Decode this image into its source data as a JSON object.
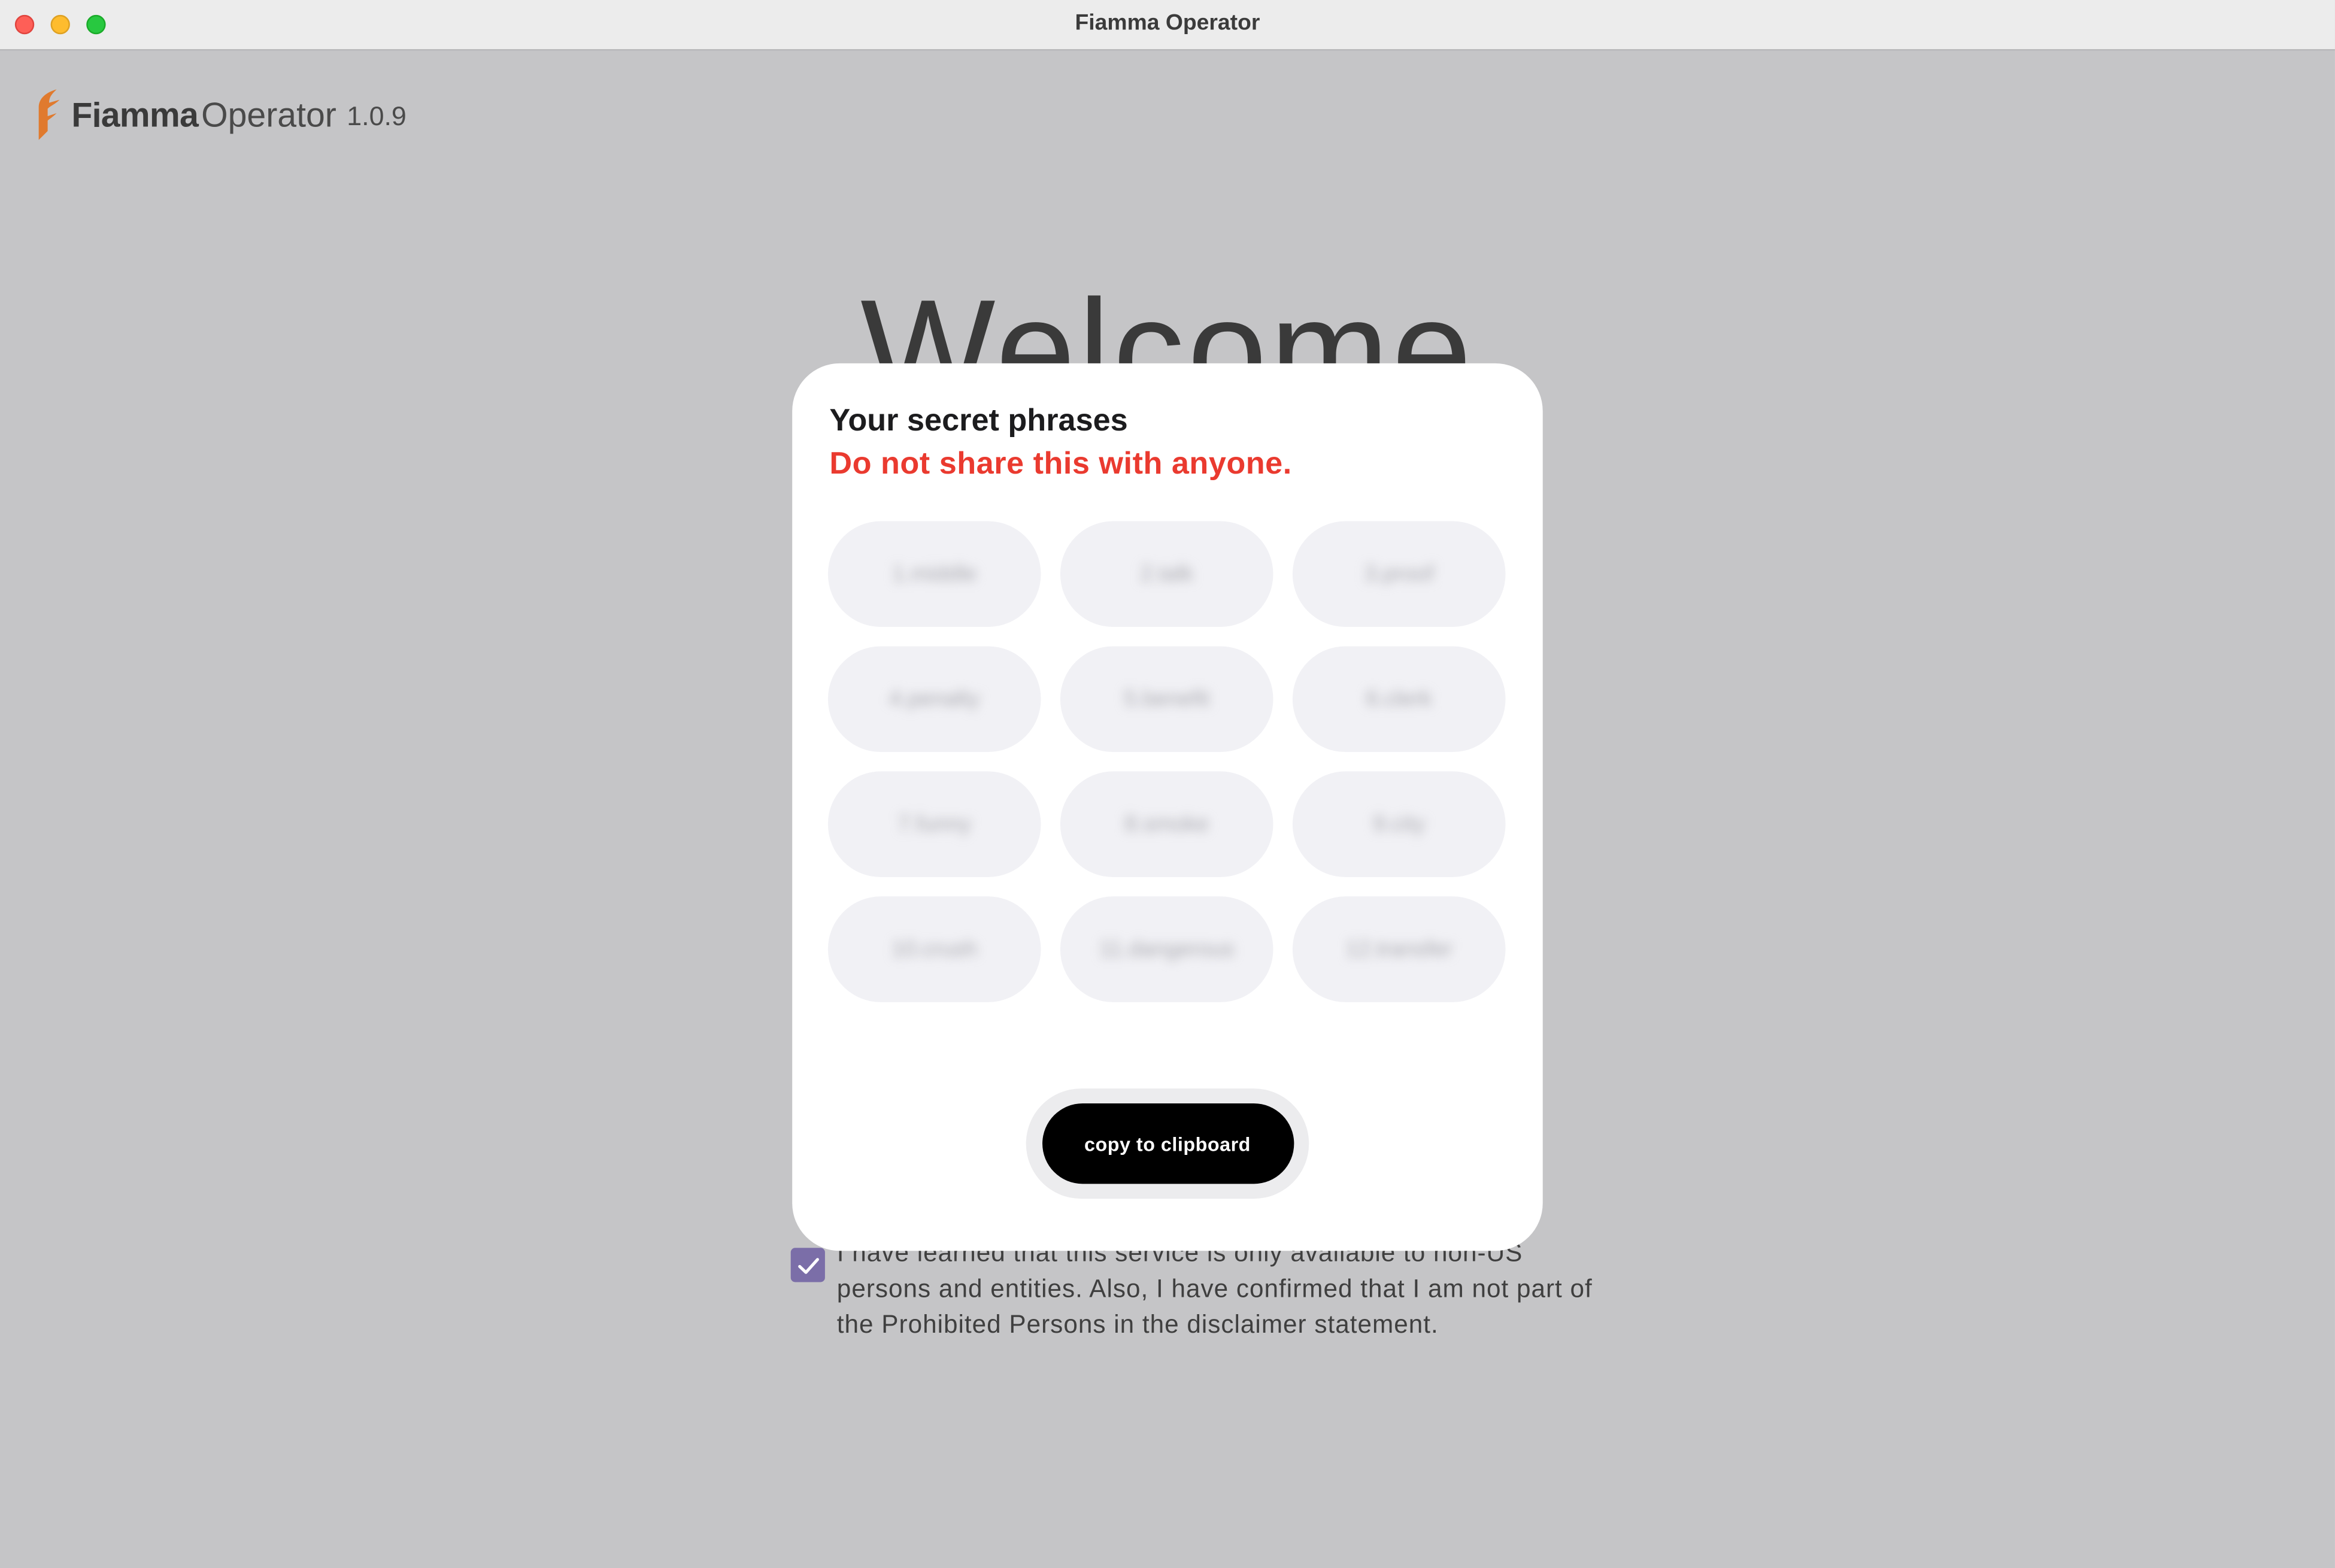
{
  "window": {
    "title": "Fiamma Operator"
  },
  "brand": {
    "logo_icon": "fiamma-flame-logo",
    "name": "Fiamma",
    "product": "Operator",
    "version": "1.0.9"
  },
  "main": {
    "heading": "Welcome"
  },
  "consent": {
    "checked": true,
    "text": "I have learned that this service is only available to non-US persons and entities. Also, I have confirmed that I am not part of the Prohibited Persons in the disclaimer statement."
  },
  "modal": {
    "title": "Your secret phrases",
    "warning": "Do not share this with anyone.",
    "words": [
      "1.middle",
      "2.talk",
      "3.proof",
      "4.penalty",
      "5.benefit",
      "6.clerk",
      "7.funny",
      "8.smoke",
      "9.city",
      "10.crush",
      "11.dangerous",
      "12.transfer"
    ],
    "copy_label": "copy to clipboard"
  },
  "colors": {
    "overlay_background": "#c5c5c7",
    "warning_red": "#ea3a2f",
    "checkbox_purple": "#7b6ea8",
    "word_chip": "#f1f1f5",
    "button_black": "#000000"
  }
}
